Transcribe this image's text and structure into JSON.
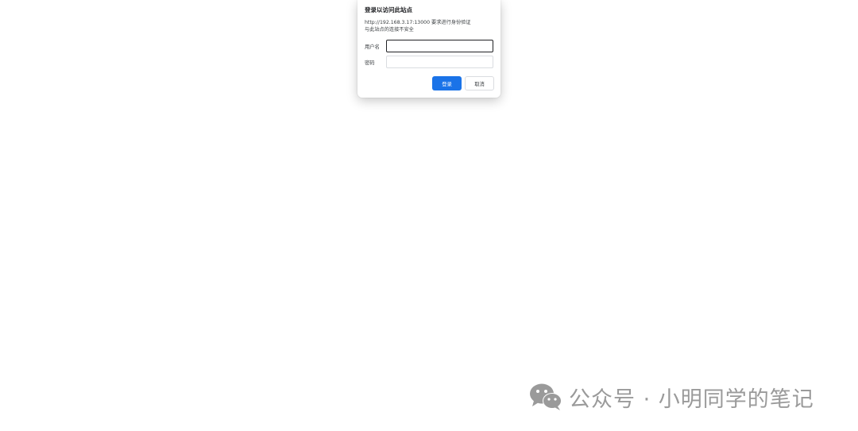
{
  "dialog": {
    "title": "登录以访问此站点",
    "message_line1": "http://192.168.3.17:13000 要求进行身份验证",
    "message_line2": "与此站点的连接不安全",
    "username_label": "用户名",
    "username_value": "",
    "password_label": "密码",
    "password_value": "",
    "login_button": "登录",
    "cancel_button": "取消",
    "accent_color": "#1a73e8"
  },
  "watermark": {
    "icon": "wechat-icon",
    "text": "公众号 · 小明同学的笔记"
  }
}
